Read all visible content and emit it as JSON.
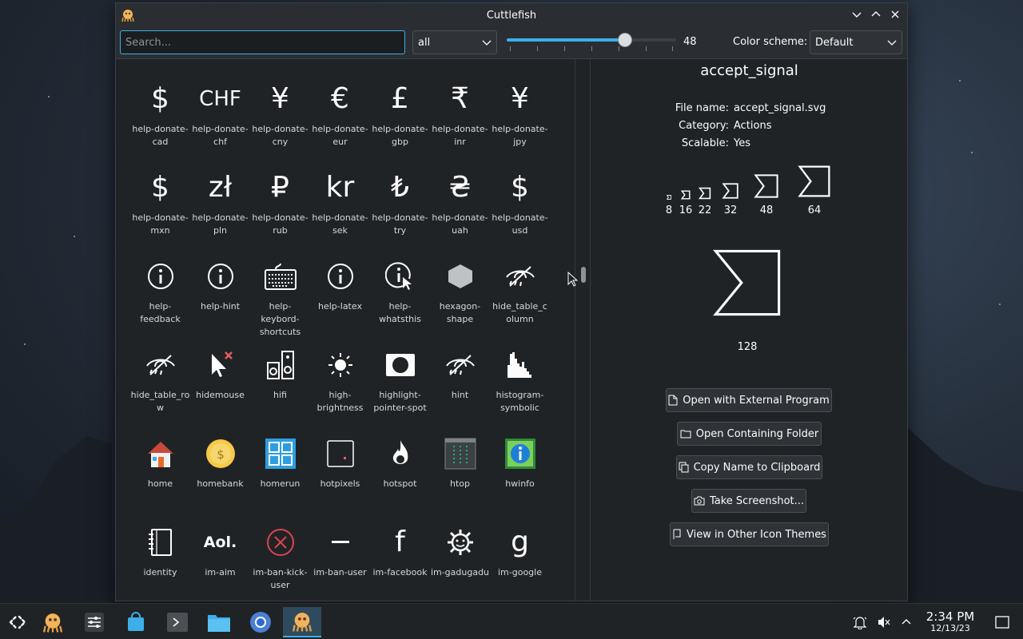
{
  "window": {
    "title": "Cuttlefish"
  },
  "toolbar": {
    "search_placeholder": "Search...",
    "category_selected": "all",
    "icon_size": "48",
    "icon_size_value": 48,
    "icon_size_range": [
      8,
      64
    ],
    "color_scheme_label": "Color scheme:",
    "color_scheme_selected": "Default"
  },
  "icons": [
    {
      "label": "help-donate-cad",
      "glyph": "$",
      "icon": "dollar-icon"
    },
    {
      "label": "help-donate-chf",
      "glyph": "CHF",
      "icon": "chf-icon"
    },
    {
      "label": "help-donate-cny",
      "glyph": "¥",
      "icon": "yuan-icon"
    },
    {
      "label": "help-donate-eur",
      "glyph": "€",
      "icon": "euro-icon"
    },
    {
      "label": "help-donate-gbp",
      "glyph": "£",
      "icon": "pound-icon"
    },
    {
      "label": "help-donate-inr",
      "glyph": "₹",
      "icon": "rupee-icon"
    },
    {
      "label": "help-donate-jpy",
      "glyph": "¥",
      "icon": "yen-icon"
    },
    {
      "label": "help-donate-mxn",
      "glyph": "$",
      "icon": "peso-icon"
    },
    {
      "label": "help-donate-pln",
      "glyph": "zł",
      "icon": "zloty-icon"
    },
    {
      "label": "help-donate-rub",
      "glyph": "₽",
      "icon": "ruble-icon"
    },
    {
      "label": "help-donate-sek",
      "glyph": "kr",
      "icon": "krona-icon"
    },
    {
      "label": "help-donate-try",
      "glyph": "₺",
      "icon": "lira-icon"
    },
    {
      "label": "help-donate-uah",
      "glyph": "₴",
      "icon": "hryvnia-icon"
    },
    {
      "label": "help-donate-usd",
      "glyph": "$",
      "icon": "dollar-icon"
    },
    {
      "label": "help-feedback",
      "glyph": "",
      "icon": "info-circle-icon"
    },
    {
      "label": "help-hint",
      "glyph": "",
      "icon": "info-circle-icon"
    },
    {
      "label": "help-keybord-shortcuts",
      "glyph": "",
      "icon": "keyboard-icon"
    },
    {
      "label": "help-latex",
      "glyph": "",
      "icon": "info-circle-icon"
    },
    {
      "label": "help-whatsthis",
      "glyph": "",
      "icon": "info-pointer-icon"
    },
    {
      "label": "hexagon-shape",
      "glyph": "",
      "icon": "hexagon-icon"
    },
    {
      "label": "hide_table_column",
      "glyph": "",
      "icon": "eye-slash-icon"
    },
    {
      "label": "hide_table_row",
      "glyph": "",
      "icon": "eye-slash-icon"
    },
    {
      "label": "hidemouse",
      "glyph": "",
      "icon": "cursor-x-icon"
    },
    {
      "label": "hifi",
      "glyph": "",
      "icon": "speaker-icon"
    },
    {
      "label": "high-brightness",
      "glyph": "",
      "icon": "sun-icon"
    },
    {
      "label": "highlight-pointer-spot",
      "glyph": "",
      "icon": "spotlight-icon"
    },
    {
      "label": "hint",
      "glyph": "",
      "icon": "eye-slash-icon"
    },
    {
      "label": "histogram-symbolic",
      "glyph": "",
      "icon": "histogram-icon"
    },
    {
      "label": "home",
      "glyph": "",
      "icon": "house-icon"
    },
    {
      "label": "homebank",
      "glyph": "",
      "icon": "coin-icon"
    },
    {
      "label": "homerun",
      "glyph": "",
      "icon": "grid-icon"
    },
    {
      "label": "hotpixels",
      "glyph": "",
      "icon": "hotpixel-icon"
    },
    {
      "label": "hotspot",
      "glyph": "",
      "icon": "flame-icon"
    },
    {
      "label": "htop",
      "glyph": "",
      "icon": "terminal-icon"
    },
    {
      "label": "hwinfo",
      "glyph": "",
      "icon": "chip-info-icon"
    },
    {
      "label": "identity",
      "glyph": "",
      "icon": "contact-book-icon"
    },
    {
      "label": "im-aim",
      "glyph": "Aol.",
      "icon": "aol-icon"
    },
    {
      "label": "im-ban-kick-user",
      "glyph": "",
      "icon": "ban-circle-icon"
    },
    {
      "label": "im-ban-user",
      "glyph": "",
      "icon": "minus-icon"
    },
    {
      "label": "im-facebook",
      "glyph": "f",
      "icon": "facebook-icon"
    },
    {
      "label": "im-gadugadu",
      "glyph": "",
      "icon": "gadugadu-icon"
    },
    {
      "label": "im-google",
      "glyph": "g",
      "icon": "google-icon"
    }
  ],
  "details": {
    "title": "accept_signal",
    "file_name_label": "File name:",
    "file_name": "accept_signal.svg",
    "category_label": "Category:",
    "category": "Actions",
    "scalable_label": "Scalable:",
    "scalable": "Yes",
    "sizes": [
      "8",
      "16",
      "22",
      "32",
      "48",
      "64"
    ],
    "large_size": "128",
    "buttons": {
      "open_external": "Open with External Program",
      "open_folder": "Open Containing Folder",
      "copy_name": "Copy Name to Clipboard",
      "screenshot": "Take Screenshot...",
      "other_themes": "View in Other Icon Themes"
    }
  },
  "taskbar": {
    "time": "2:34 PM",
    "date": "12/13/23"
  },
  "colors": {
    "accent": "#3daee9",
    "window_bg": "#202326",
    "titlebar_bg": "#2a2e32"
  }
}
